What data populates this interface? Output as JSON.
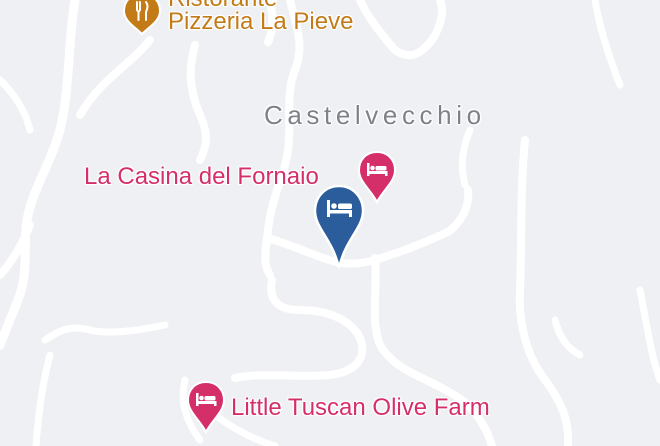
{
  "map": {
    "locality": "Castelvecchio",
    "restaurant": {
      "line1": "Ristorante",
      "line2": "Pizzeria La Pieve",
      "icon": "fork-knife-icon"
    },
    "hotels": [
      {
        "name": "La Casina del Fornaio",
        "icon": "bed-icon"
      },
      {
        "name": "Little Tuscan Olive Farm",
        "icon": "bed-icon"
      }
    ],
    "selected_marker": {
      "icon": "bed-icon"
    },
    "colors": {
      "background": "#eef0f3",
      "road": "#ffffff",
      "restaurant": "#c27b16",
      "hotel": "#d52f6a",
      "selected_pin": "#2b5d9c",
      "locality_text": "#7d8288"
    }
  }
}
